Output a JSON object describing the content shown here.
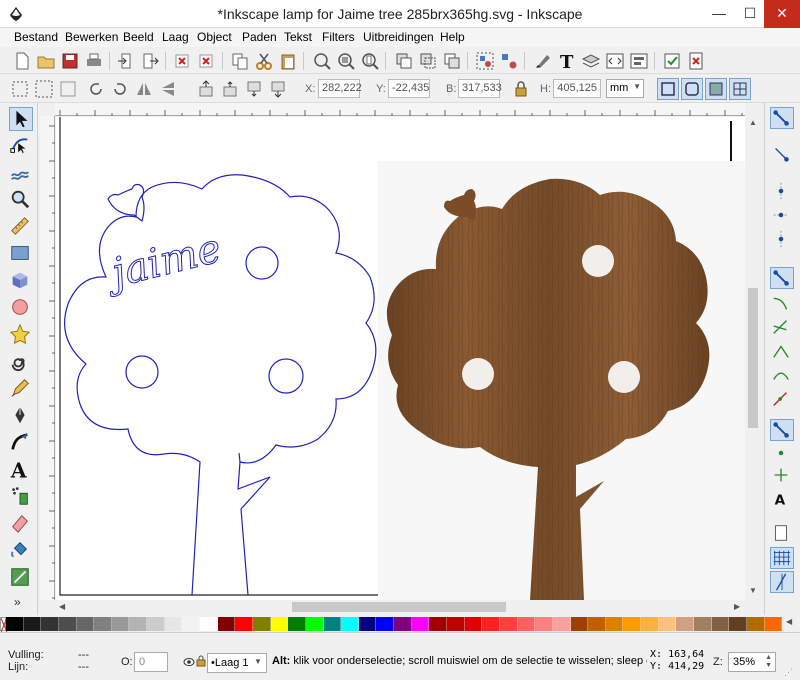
{
  "window": {
    "title": "*Inkscape lamp for Jaime tree 285brx365hg.svg - Inkscape",
    "minimize": "—",
    "maximize": "☐",
    "close": "✕",
    "close_color": "#c42b1c"
  },
  "menu": {
    "items": [
      {
        "label": "Bestand",
        "key": "B"
      },
      {
        "label": "Bewerken",
        "key": "w"
      },
      {
        "label": "Beeld",
        "key": "l"
      },
      {
        "label": "Laag",
        "key": "L"
      },
      {
        "label": "Object",
        "key": "O"
      },
      {
        "label": "Paden",
        "key": "P"
      },
      {
        "label": "Tekst",
        "key": "T"
      },
      {
        "label": "Filters",
        "key": "F"
      },
      {
        "label": "Uitbreidingen",
        "key": "U"
      },
      {
        "label": "Help",
        "key": "H"
      }
    ]
  },
  "toolbar": {
    "icons": [
      "new-document-icon",
      "open-icon",
      "save-icon",
      "print-icon",
      "import-icon",
      "export-icon",
      "undo-icon",
      "redo-icon",
      "copy-icon",
      "cut-icon",
      "paste-icon",
      "zoom-selection-icon",
      "zoom-drawing-icon",
      "zoom-page-icon",
      "duplicate-icon",
      "clone-icon",
      "unlink-clone-icon",
      "group-icon",
      "ungroup-icon",
      "fill-stroke-icon",
      "text-font-icon",
      "layers-icon",
      "xml-editor-icon",
      "align-icon",
      "preferences-icon",
      "document-properties-icon"
    ]
  },
  "selection": {
    "x_label": "X:",
    "x_value": "282,222",
    "y_label": "Y:",
    "y_value": "-22,435",
    "w_label": "B:",
    "w_value": "317,533",
    "h_label": "H:",
    "h_value": "405,125",
    "unit": "mm"
  },
  "tools": [
    "selector-tool-icon",
    "node-tool-icon",
    "tweak-tool-icon",
    "zoom-tool-icon",
    "measure-tool-icon",
    "rectangle-tool-icon",
    "3d-box-tool-icon",
    "ellipse-tool-icon",
    "star-tool-icon",
    "spiral-tool-icon",
    "pencil-tool-icon",
    "pen-tool-icon",
    "calligraphy-tool-icon",
    "text-tool-icon",
    "spray-tool-icon",
    "eraser-tool-icon",
    "paint-bucket-tool-icon",
    "gradient-tool-icon"
  ],
  "more_tools": "»",
  "canvas": {
    "name_text": "jaime"
  },
  "palette": [
    "#000000",
    "#1a1a1a",
    "#333333",
    "#4d4d4d",
    "#666666",
    "#808080",
    "#999999",
    "#b3b3b3",
    "#cccccc",
    "#e6e6e6",
    "#f2f2f2",
    "#ffffff",
    "#800000",
    "#ff0000",
    "#808000",
    "#ffff00",
    "#008000",
    "#00ff00",
    "#008080",
    "#00ffff",
    "#000080",
    "#0000ff",
    "#800080",
    "#ff00ff",
    "#a00000",
    "#c00000",
    "#e00000",
    "#ff2020",
    "#ff4040",
    "#ff6060",
    "#ff8080",
    "#ffa0a0",
    "#a04000",
    "#c06000",
    "#e08000",
    "#ff9a00",
    "#ffb040",
    "#ffc080",
    "#d0a080",
    "#a08060",
    "#806040",
    "#604020",
    "#b36b00",
    "#ff6600"
  ],
  "status": {
    "fill_label": "Vulling:",
    "fill_value": "---",
    "stroke_label": "Lijn:",
    "stroke_value": "---",
    "opacity_label": "O:",
    "opacity_value": "0",
    "layer": "•Laag 1",
    "message_key": "Alt:",
    "message": "klik voor onderselectie; scroll muiswiel om de selectie te wisselen; sleep om",
    "x_label": "X:",
    "x_value": "163,64",
    "y_label": "Y:",
    "y_value": "414,29",
    "zoom_label": "Z:",
    "zoom_value": "35%"
  }
}
